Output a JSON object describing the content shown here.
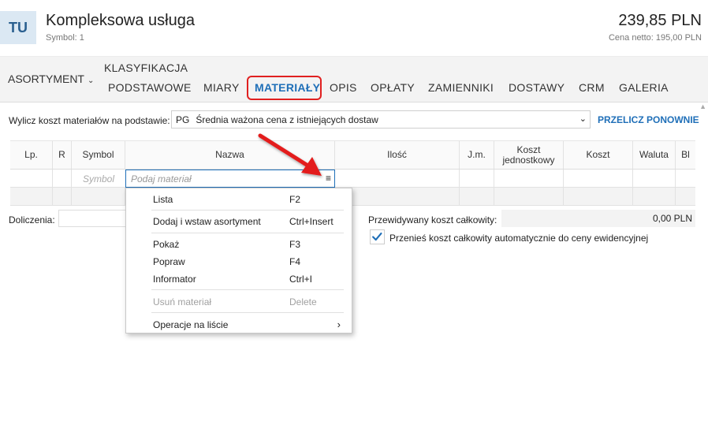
{
  "header": {
    "avatar": "TU",
    "title": "Kompleksowa usługa",
    "symbol": "Symbol: 1",
    "price": "239,85 PLN",
    "netto": "Cena netto: 195,00 PLN"
  },
  "tabs": {
    "asortyment": "ASORTYMENT",
    "klasyfikacja": "KLASYFIKACJA",
    "items": [
      "PODSTAWOWE",
      "MIARY",
      "MATERIAŁY",
      "OPIS",
      "OPŁATY",
      "ZAMIENNIKI",
      "DOSTAWY",
      "CRM",
      "GALERIA"
    ],
    "active": "MATERIAŁY"
  },
  "calc": {
    "label": "Wylicz koszt materiałów na podstawie:",
    "code": "PG",
    "value": "Średnia ważona cena z istniejących dostaw",
    "recalc": "PRZELICZ PONOWNIE"
  },
  "grid": {
    "columns": [
      "Lp.",
      "R",
      "Symbol",
      "Nazwa",
      "Ilość",
      "J.m.",
      "Koszt jednostkowy",
      "Koszt",
      "Waluta",
      "Bl"
    ],
    "symbol_placeholder": "Symbol",
    "name_placeholder": "Podaj materiał"
  },
  "footer": {
    "doliczenia": "Doliczenia:",
    "pred_label": "Przewidywany koszt całkowity:",
    "pred_value": "0,00 PLN",
    "transfer_label": "Przenieś koszt całkowity automatycznie do ceny ewidencyjnej"
  },
  "menu": {
    "items": [
      {
        "label": "Lista",
        "shortcut": "F2"
      },
      {
        "label": "Dodaj i wstaw asortyment",
        "shortcut": "Ctrl+Insert"
      },
      {
        "label": "Pokaż",
        "shortcut": "F3"
      },
      {
        "label": "Popraw",
        "shortcut": "F4"
      },
      {
        "label": "Informator",
        "shortcut": "Ctrl+I"
      },
      {
        "label": "Usuń materiał",
        "shortcut": "Delete"
      },
      {
        "label": "Operacje na liście",
        "shortcut": ""
      }
    ]
  },
  "colors": {
    "accent": "#1f6fb8",
    "highlight": "#e02020"
  }
}
